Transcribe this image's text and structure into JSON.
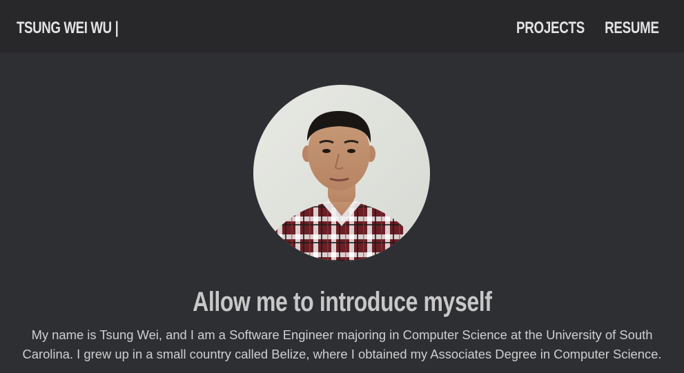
{
  "header": {
    "brand": "TSUNG WEI WU |",
    "nav": [
      {
        "label": "PROJECTS"
      },
      {
        "label": "RESUME"
      }
    ]
  },
  "hero": {
    "avatar_alt": "Profile photo",
    "headline": "Allow me to introduce myself",
    "bio_line1": "My name is Tsung Wei, and I am a Software Engineer majoring in Computer Science at the University of South",
    "bio_line2": "Carolina. I grew up in a small country called Belize, where I obtained my Associates Degree in Computer Science."
  },
  "colors": {
    "page_background": "#2e2f33",
    "navbar_background": "#28282b",
    "text_primary": "#e3e3e3",
    "text_secondary": "#cfcfcf"
  }
}
